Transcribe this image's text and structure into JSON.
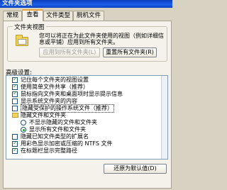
{
  "window": {
    "title": "文件夹选项"
  },
  "tabs": [
    {
      "label": "常规"
    },
    {
      "label": "查看"
    },
    {
      "label": "文件类型"
    },
    {
      "label": "脱机文件"
    }
  ],
  "folder_views": {
    "group_label": "文件夹视图",
    "description": "您可以将正在为此文件夹使用的视图（例如详细信息或平铺）应用到所有文件夹。",
    "apply_button": "应用到所有文件夹(L)",
    "reset_button": "重置所有文件夹(R)"
  },
  "advanced": {
    "label": "高级设置:",
    "items": [
      {
        "type": "checkbox",
        "checked": true,
        "text": "记住每个文件夹的视图设置"
      },
      {
        "type": "checkbox",
        "checked": true,
        "text": "使用简单文件共享（推荐）"
      },
      {
        "type": "checkbox",
        "checked": true,
        "text": "鼠标指向文件夹和桌面项时显示提示信息"
      },
      {
        "type": "checkbox",
        "checked": false,
        "text": "显示系统文件夹的内容"
      },
      {
        "type": "checkbox",
        "checked": false,
        "text": "隐藏受保护的操作系统文件（推荐）"
      },
      {
        "type": "folder",
        "text": "隐藏文件和文件夹"
      },
      {
        "type": "radio",
        "selected": false,
        "text": "不显示隐藏的文件和文件夹"
      },
      {
        "type": "radio",
        "selected": true,
        "text": "显示所有文件和文件夹"
      },
      {
        "type": "checkbox",
        "checked": false,
        "text": "隐藏已知文件类型的扩展名"
      },
      {
        "type": "checkbox",
        "checked": true,
        "text": "用彩色显示加密或压缩的 NTFS 文件"
      },
      {
        "type": "checkbox",
        "checked": true,
        "text": "在标题栏显示完整路径"
      }
    ],
    "restore_button": "还原为默认值(D)"
  }
}
